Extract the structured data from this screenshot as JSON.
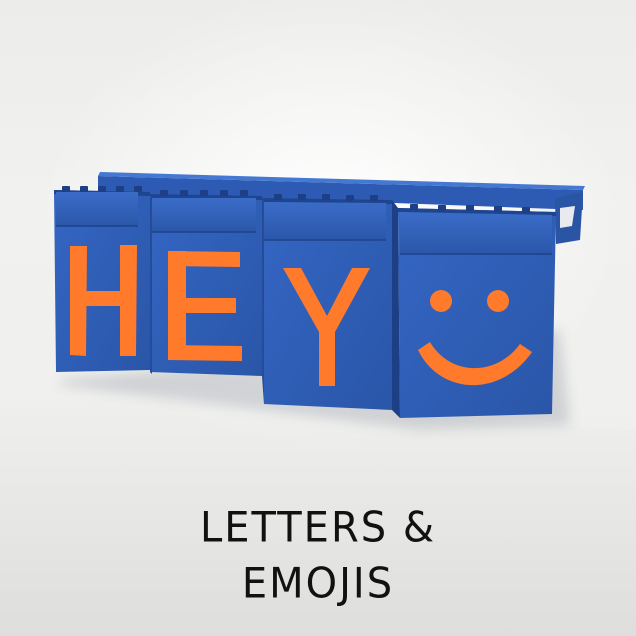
{
  "tiles": [
    {
      "kind": "letter",
      "glyph": "H"
    },
    {
      "kind": "letter",
      "glyph": "E"
    },
    {
      "kind": "letter",
      "glyph": "Y"
    },
    {
      "kind": "emoji",
      "glyph": "smiley-face-icon"
    }
  ],
  "caption": {
    "line1": "LETTERS &",
    "line2": "EMOJIS"
  },
  "colors": {
    "tile_blue": "#2f5fb8",
    "tile_blue_dark": "#234a96",
    "glyph_orange": "#ff7a2a",
    "wall": "#efefed",
    "caption_text": "#111111"
  }
}
